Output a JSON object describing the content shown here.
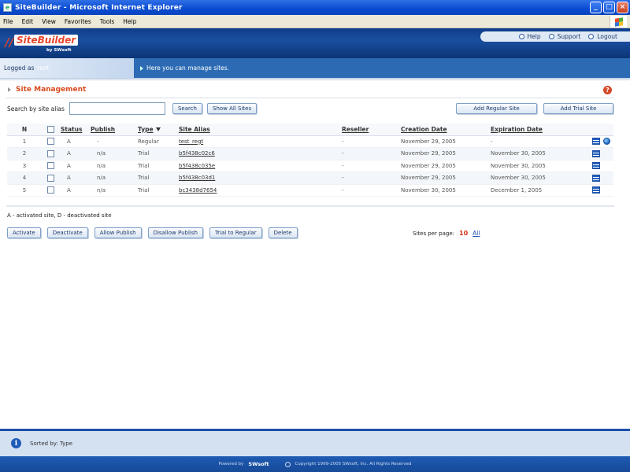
{
  "window": {
    "title": "SiteBuilder - Microsoft Internet Explorer",
    "minimize_glyph": "_",
    "maximize_glyph": "□",
    "close_glyph": "×"
  },
  "menu": [
    "File",
    "Edit",
    "View",
    "Favorites",
    "Tools",
    "Help"
  ],
  "header": {
    "logo_text": "SiteBuilder",
    "logo_by": "by SWsoft",
    "links": [
      "Help",
      "Support",
      "Logout"
    ]
  },
  "logged": {
    "label": "Logged as",
    "user": "root",
    "message": "Here you can manage sites."
  },
  "section": {
    "title": "Site Management",
    "help_glyph": "?"
  },
  "search": {
    "label": "Search by site alias",
    "value": "",
    "search_button": "Search",
    "show_all_button": "Show All Sites",
    "add_regular_button": "Add Regular Site",
    "add_trial_button": "Add Trial Site"
  },
  "table": {
    "headers": {
      "n": "N",
      "status": "Status",
      "publish": "Publish",
      "type": "Type",
      "alias": "Site Alias",
      "reseller": "Reseller",
      "created": "Creation Date",
      "expires": "Expiration Date"
    },
    "rows": [
      {
        "n": "1",
        "status": "A",
        "publish": "-",
        "type": "Regular",
        "alias": "test_regt",
        "reseller": "-",
        "created": "November 29, 2005",
        "expires": "-"
      },
      {
        "n": "2",
        "status": "A",
        "publish": "n/a",
        "type": "Trial",
        "alias": "b5f438c02c6",
        "reseller": "-",
        "created": "November 29, 2005",
        "expires": "November 30, 2005"
      },
      {
        "n": "3",
        "status": "A",
        "publish": "n/a",
        "type": "Trial",
        "alias": "b5f438c035e",
        "reseller": "-",
        "created": "November 29, 2005",
        "expires": "November 30, 2005"
      },
      {
        "n": "4",
        "status": "A",
        "publish": "n/a",
        "type": "Trial",
        "alias": "b5f438c03d1",
        "reseller": "-",
        "created": "November 29, 2005",
        "expires": "November 30, 2005"
      },
      {
        "n": "5",
        "status": "A",
        "publish": "n/a",
        "type": "Trial",
        "alias": "bc3438d7654",
        "reseller": "-",
        "created": "November 30, 2005",
        "expires": "December 1, 2005"
      }
    ]
  },
  "legend": "A - activated site, D - deactivated site",
  "actions": [
    "Activate",
    "Deactivate",
    "Allow Publish",
    "Disallow Publish",
    "Trial to Regular",
    "Delete"
  ],
  "paging": {
    "label": "Sites per page:",
    "current": "10",
    "all": "All"
  },
  "status": {
    "sorted_by": "Sorted by: Type",
    "info_glyph": "i"
  },
  "footer": {
    "powered": "Powered by",
    "brand": "SWsoft",
    "copyright": "Copyright 1999-2005 SWsoft, Inc. All Rights Reserved"
  }
}
